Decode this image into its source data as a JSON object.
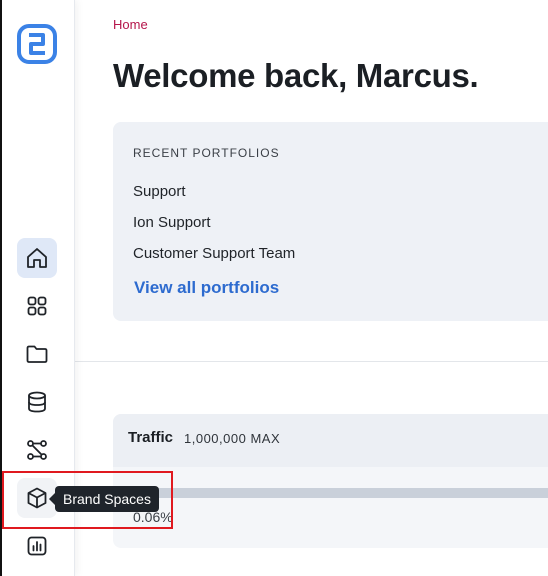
{
  "sidebar": {
    "logo_icon": "brand-logo-icon",
    "items": [
      {
        "id": "home",
        "icon": "home-icon",
        "active": true
      },
      {
        "id": "dashboard",
        "icon": "grid-icon"
      },
      {
        "id": "folders",
        "icon": "folder-icon"
      },
      {
        "id": "data",
        "icon": "database-icon"
      },
      {
        "id": "workflows",
        "icon": "nodes-icon"
      },
      {
        "id": "brand-spaces",
        "icon": "cube-icon"
      },
      {
        "id": "reports",
        "icon": "bar-chart-icon"
      }
    ],
    "tooltip": "Brand Spaces"
  },
  "header": {
    "breadcrumb": "Home",
    "title": "Welcome back, Marcus."
  },
  "recent_portfolios": {
    "heading": "RECENT PORTFOLIOS",
    "items": [
      "Support",
      "Ion Support",
      "Customer Support Team"
    ],
    "view_all_label": "View all portfolios"
  },
  "traffic": {
    "title": "Traffic",
    "max_label": "1,000,000 MAX",
    "percent_label": "0.06%",
    "percent_value": 0.06
  },
  "colors": {
    "accent": "#2d6bcf",
    "breadcrumb": "#b5164b",
    "highlight": "#e0191f"
  }
}
